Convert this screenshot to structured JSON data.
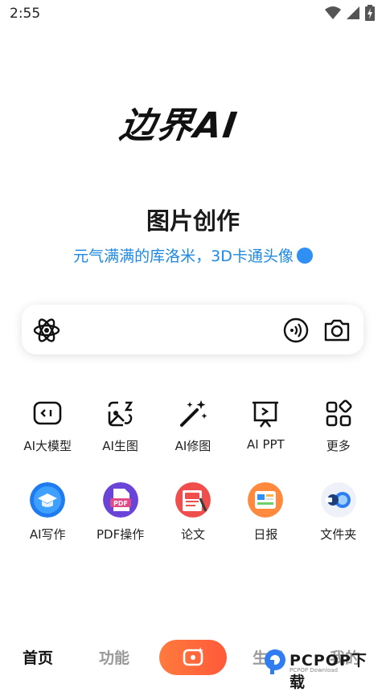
{
  "status_bar": {
    "time": "2:55"
  },
  "logo": {
    "text": "边界AI"
  },
  "hero": {
    "title": "图片创作",
    "subtitle": "元气满满的库洛米，3D卡通头像"
  },
  "tools": [
    {
      "label": "AI大模型",
      "icon": "chat-bubble-icon"
    },
    {
      "label": "AI生图",
      "icon": "image-gen-icon"
    },
    {
      "label": "AI修图",
      "icon": "magic-wand-icon"
    },
    {
      "label": "AI PPT",
      "icon": "presentation-icon"
    },
    {
      "label": "更多",
      "icon": "grid-more-icon"
    }
  ],
  "apps": [
    {
      "label": "AI写作",
      "icon": "graduation-cap-icon",
      "color": "#1e7bf0"
    },
    {
      "label": "PDF操作",
      "icon": "pdf-icon",
      "color": "#6a43d8"
    },
    {
      "label": "论文",
      "icon": "paper-icon",
      "color": "#f04d4d"
    },
    {
      "label": "日报",
      "icon": "daily-report-icon",
      "color": "#ff8a3d"
    },
    {
      "label": "文件夹",
      "icon": "folder-icon",
      "color": "#e8eef8"
    }
  ],
  "tabbar": {
    "home": "首页",
    "features": "功能",
    "generate": "生图",
    "mine": "我的"
  },
  "watermark": {
    "text": "PCPOP下载",
    "subtext": "PCPOP Download"
  },
  "colors": {
    "accent": "#1e88e5",
    "orange": "#ff6a3a"
  }
}
